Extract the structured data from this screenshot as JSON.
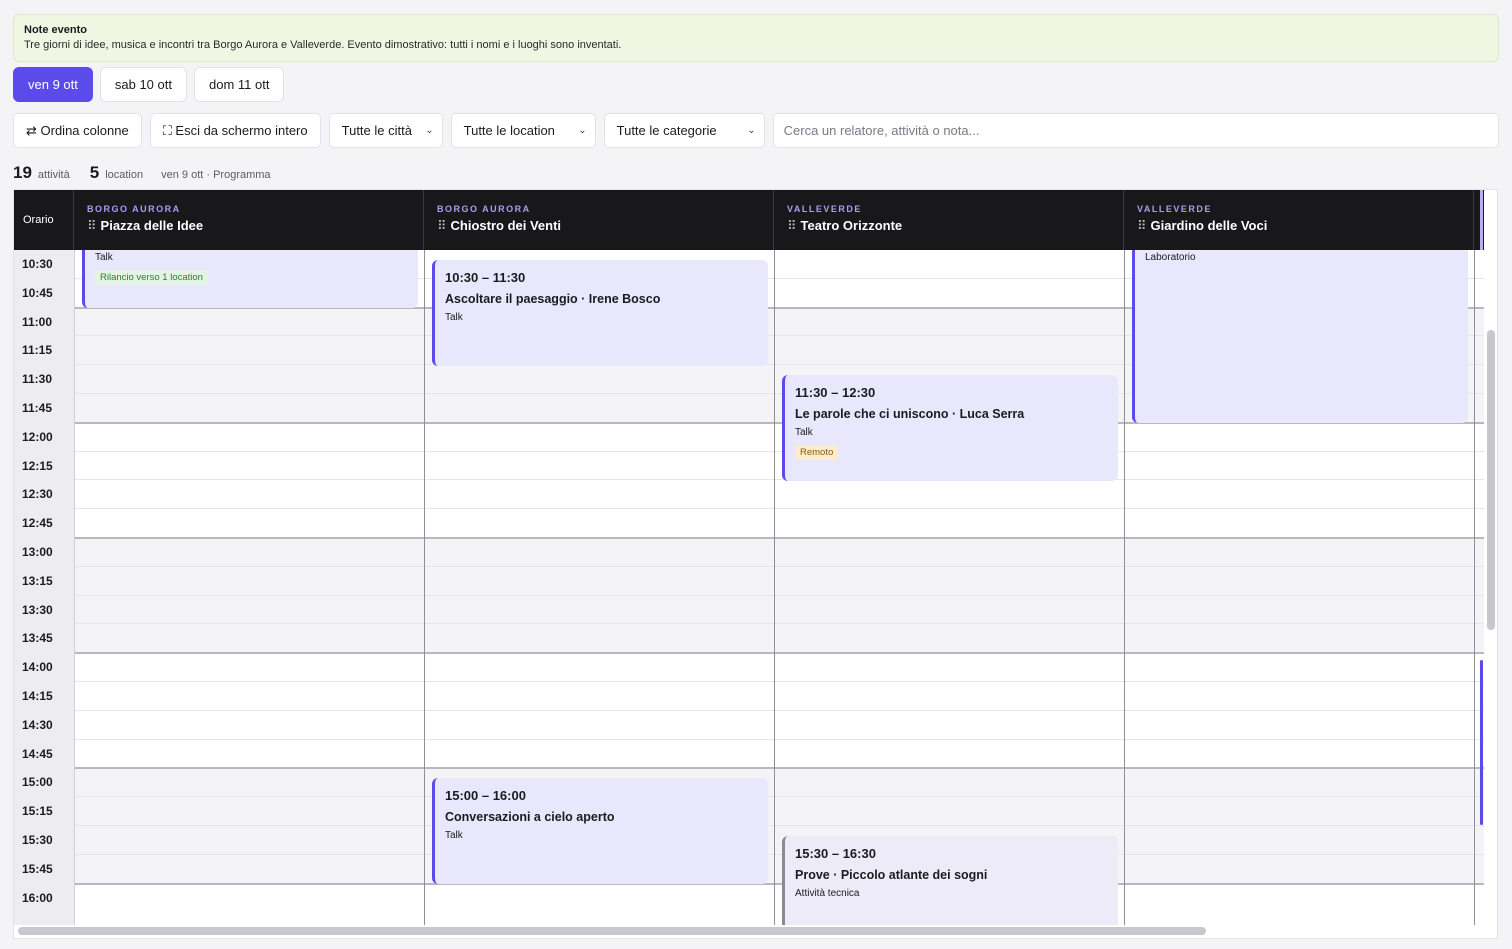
{
  "notes": {
    "title": "Note evento",
    "text": "Tre giorni di idee, musica e incontri tra Borgo Aurora e Valleverde. Evento dimostrativo: tutti i nomi e i luoghi sono inventati."
  },
  "days": [
    "ven 9 ott",
    "sab 10 ott",
    "dom 11 ott"
  ],
  "toolbar": {
    "order_label": "⇄ Ordina colonne",
    "fullscreen_label": "⛶ Esci da schermo intero",
    "city_select": "Tutte le città",
    "location_select": "Tutte le location",
    "category_select": "Tutte le categorie",
    "search_placeholder": "Cerca un relatore, attività o nota..."
  },
  "stats": {
    "activities_count": "19",
    "activities_label": "attività",
    "locations_count": "5",
    "locations_label": "location",
    "context": "ven 9 ott · Programma"
  },
  "grid": {
    "time_header": "Orario",
    "columns": [
      {
        "city": "BORGO AURORA",
        "location": "Piazza delle Idee"
      },
      {
        "city": "BORGO AURORA",
        "location": "Chiostro dei Venti"
      },
      {
        "city": "VALLEVERDE",
        "location": "Teatro Orizzonte"
      },
      {
        "city": "VALLEVERDE",
        "location": "Giardino delle Voci"
      }
    ],
    "times": [
      "10:30",
      "10:45",
      "11:00",
      "11:15",
      "11:30",
      "11:45",
      "12:00",
      "12:15",
      "12:30",
      "12:45",
      "13:00",
      "13:15",
      "13:30",
      "13:45",
      "14:00",
      "14:15",
      "14:30",
      "14:45",
      "15:00",
      "15:15",
      "15:30",
      "15:45",
      "16:00"
    ]
  },
  "events": [
    {
      "id": "e1",
      "category": "Talk",
      "tag": "Rilancio verso 1 location"
    },
    {
      "id": "e2",
      "time": "10:30 – 11:30",
      "title": "Ascoltare il paesaggio · Irene Bosco",
      "category": "Talk"
    },
    {
      "id": "e3",
      "category": "Laboratorio"
    },
    {
      "id": "e4",
      "time": "11:30 – 12:30",
      "title": "Le parole che ci uniscono · Luca Serra",
      "category": "Talk",
      "tag": "Remoto"
    },
    {
      "id": "e5",
      "time": "15:00 – 16:00",
      "title": "Conversazioni a cielo aperto",
      "category": "Talk"
    },
    {
      "id": "e6",
      "time": "15:30 – 16:30",
      "title": "Prove · Piccolo atlante dei sogni",
      "category": "Attività tecnica"
    }
  ]
}
